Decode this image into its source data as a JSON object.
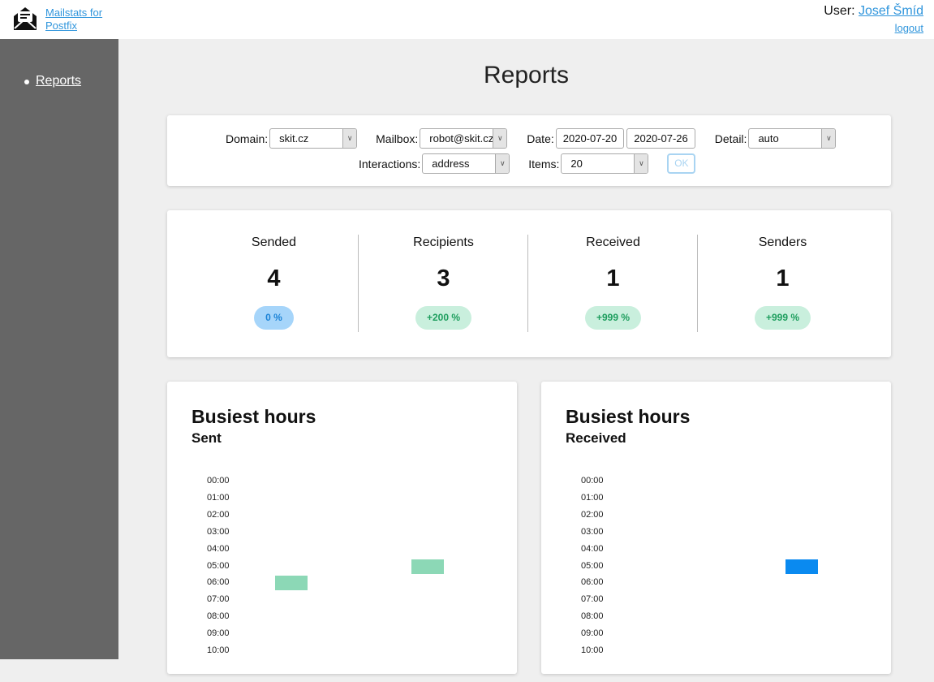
{
  "header": {
    "app_name": "Mailstats for Postfix",
    "user_label": "User:",
    "user_name": "Josef Šmíd",
    "logout": "logout"
  },
  "sidebar": {
    "items": [
      {
        "label": "Reports"
      }
    ]
  },
  "page": {
    "title": "Reports"
  },
  "filters": {
    "domain_label": "Domain:",
    "domain_value": "skit.cz",
    "mailbox_label": "Mailbox:",
    "mailbox_value": "robot@skit.cz",
    "date_label": "Date:",
    "date_from": "2020-07-20",
    "date_to": "2020-07-26",
    "detail_label": "Detail:",
    "detail_value": "auto",
    "interactions_label": "Interactions:",
    "interactions_value": "address",
    "items_label": "Items:",
    "items_value": "20",
    "ok_label": "OK"
  },
  "stats": [
    {
      "title": "Sended",
      "value": "4",
      "change": "0 %",
      "trend": "neutral"
    },
    {
      "title": "Recipients",
      "value": "3",
      "change": "+200 %",
      "trend": "up"
    },
    {
      "title": "Received",
      "value": "1",
      "change": "+999 %",
      "trend": "up"
    },
    {
      "title": "Senders",
      "value": "1",
      "change": "+999 %",
      "trend": "up"
    }
  ],
  "chart_data": [
    {
      "type": "heatmap",
      "title": "Busiest hours",
      "subtitle": "Sent",
      "color": "#8cd8b6",
      "y_labels": [
        "00:00",
        "01:00",
        "02:00",
        "03:00",
        "04:00",
        "05:00",
        "06:00",
        "07:00",
        "08:00",
        "09:00",
        "10:00"
      ],
      "columns": 7,
      "cells": [
        {
          "col": 1,
          "hour": 6,
          "value": 1
        },
        {
          "col": 5,
          "hour": 5,
          "value": 1
        }
      ]
    },
    {
      "type": "heatmap",
      "title": "Busiest hours",
      "subtitle": "Received",
      "color": "#0a8af0",
      "y_labels": [
        "00:00",
        "01:00",
        "02:00",
        "03:00",
        "04:00",
        "05:00",
        "06:00",
        "07:00",
        "08:00",
        "09:00",
        "10:00"
      ],
      "columns": 7,
      "cells": [
        {
          "col": 5,
          "hour": 5,
          "value": 1
        }
      ]
    }
  ]
}
